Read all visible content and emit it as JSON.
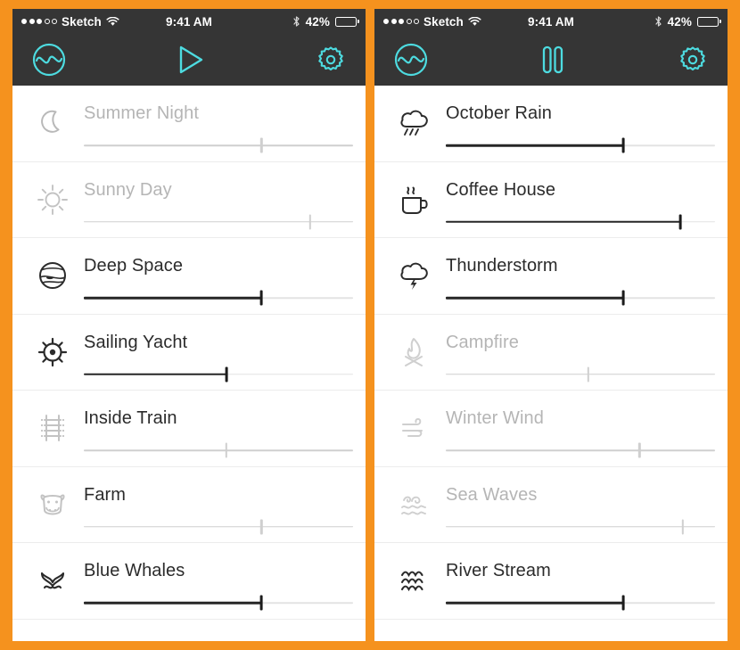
{
  "theme": {
    "background": "#F5921E",
    "bar_background": "#353535",
    "accent": "#4ddbe0",
    "active_text": "#2b2b2b",
    "inactive_text": "#b5b5b5",
    "active_track": "#262626",
    "inactive_track": "#cfcfcf"
  },
  "status_bar": {
    "carrier": "Sketch",
    "time": "9:41 AM",
    "battery_percent": "42%",
    "battery_level": 42,
    "signal_dots_filled": 3,
    "signal_dots_total": 5,
    "wifi_icon": "wifi-icon",
    "bluetooth_icon": "bluetooth-icon",
    "battery_icon": "battery-icon"
  },
  "panels": [
    {
      "id": "left",
      "toolbar": {
        "logo_icon": "wave-circle-icon",
        "logo_label": "Noizio",
        "transport_icon": "play-icon",
        "transport_label": "Play",
        "settings_icon": "gear-icon",
        "settings_label": "Settings"
      },
      "sounds": [
        {
          "name": "Summer Night",
          "icon": "moon-icon",
          "state": "off",
          "volume": 66
        },
        {
          "name": "Sunny Day",
          "icon": "sun-icon",
          "state": "off",
          "volume": 84
        },
        {
          "name": "Deep Space",
          "icon": "planet-icon",
          "state": "on",
          "volume": 66
        },
        {
          "name": "Sailing Yacht",
          "icon": "ship-wheel-icon",
          "state": "on",
          "volume": 53
        },
        {
          "name": "Inside Train",
          "icon": "train-track-icon",
          "state": "mid",
          "volume": 53
        },
        {
          "name": "Farm",
          "icon": "cow-icon",
          "state": "mid",
          "volume": 66
        },
        {
          "name": "Blue Whales",
          "icon": "whale-tail-icon",
          "state": "on",
          "volume": 66
        }
      ]
    },
    {
      "id": "right",
      "toolbar": {
        "logo_icon": "wave-circle-icon",
        "logo_label": "Noizio",
        "transport_icon": "pause-icon",
        "transport_label": "Pause",
        "settings_icon": "gear-icon",
        "settings_label": "Settings"
      },
      "sounds": [
        {
          "name": "October Rain",
          "icon": "rain-cloud-icon",
          "state": "on",
          "volume": 66
        },
        {
          "name": "Coffee House",
          "icon": "coffee-cup-icon",
          "state": "on",
          "volume": 87
        },
        {
          "name": "Thunderstorm",
          "icon": "storm-cloud-icon",
          "state": "on",
          "volume": 66
        },
        {
          "name": "Campfire",
          "icon": "campfire-icon",
          "state": "off",
          "volume": 53
        },
        {
          "name": "Winter Wind",
          "icon": "wind-icon",
          "state": "off",
          "volume": 72
        },
        {
          "name": "Sea Waves",
          "icon": "sea-waves-icon",
          "state": "off",
          "volume": 88
        },
        {
          "name": "River Stream",
          "icon": "river-waves-icon",
          "state": "on",
          "volume": 66
        }
      ]
    }
  ]
}
